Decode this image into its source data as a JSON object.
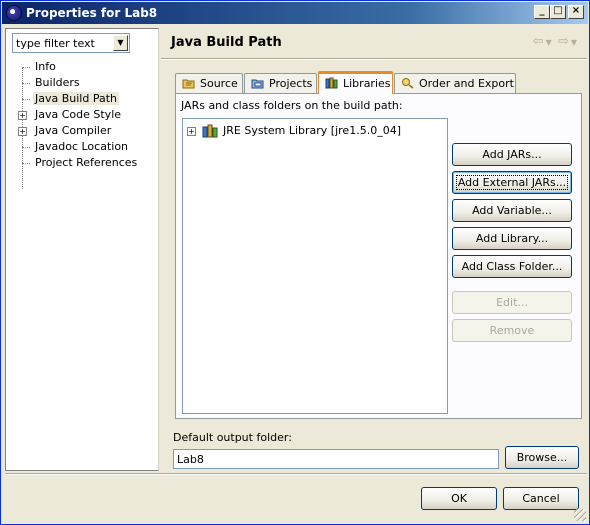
{
  "window": {
    "title": "Properties for Lab8"
  },
  "filter": {
    "value": "type filter text"
  },
  "tree": {
    "items": [
      {
        "label": "Info",
        "expandable": false
      },
      {
        "label": "Builders",
        "expandable": false
      },
      {
        "label": "Java Build Path",
        "expandable": false,
        "selected": true
      },
      {
        "label": "Java Code Style",
        "expandable": true
      },
      {
        "label": "Java Compiler",
        "expandable": true
      },
      {
        "label": "Javadoc Location",
        "expandable": false
      },
      {
        "label": "Project References",
        "expandable": false
      }
    ]
  },
  "page": {
    "title": "Java Build Path"
  },
  "tabs": [
    {
      "label": "Source",
      "icon": "source-folder-icon"
    },
    {
      "label": "Projects",
      "icon": "projects-folder-icon"
    },
    {
      "label": "Libraries",
      "icon": "libraries-icon",
      "active": true
    },
    {
      "label": "Order and Export",
      "icon": "order-export-icon"
    }
  ],
  "libraries": {
    "caption": "JARs and class folders on the build path:",
    "entries": [
      {
        "label": "JRE System Library [jre1.5.0_04]"
      }
    ],
    "buttons": {
      "add_jars": "Add JARs...",
      "add_external_jars": "Add External JARs...",
      "add_variable": "Add Variable...",
      "add_library": "Add Library...",
      "add_class_folder": "Add Class Folder...",
      "edit": "Edit...",
      "remove": "Remove"
    }
  },
  "output": {
    "label": "Default output folder:",
    "value": "Lab8",
    "browse": "Browse..."
  },
  "dialog": {
    "ok": "OK",
    "cancel": "Cancel"
  },
  "colors": {
    "title_bar": "#0a246a",
    "active_tab_accent": "#e68b2c",
    "dialog_background": "#ece9d8"
  }
}
